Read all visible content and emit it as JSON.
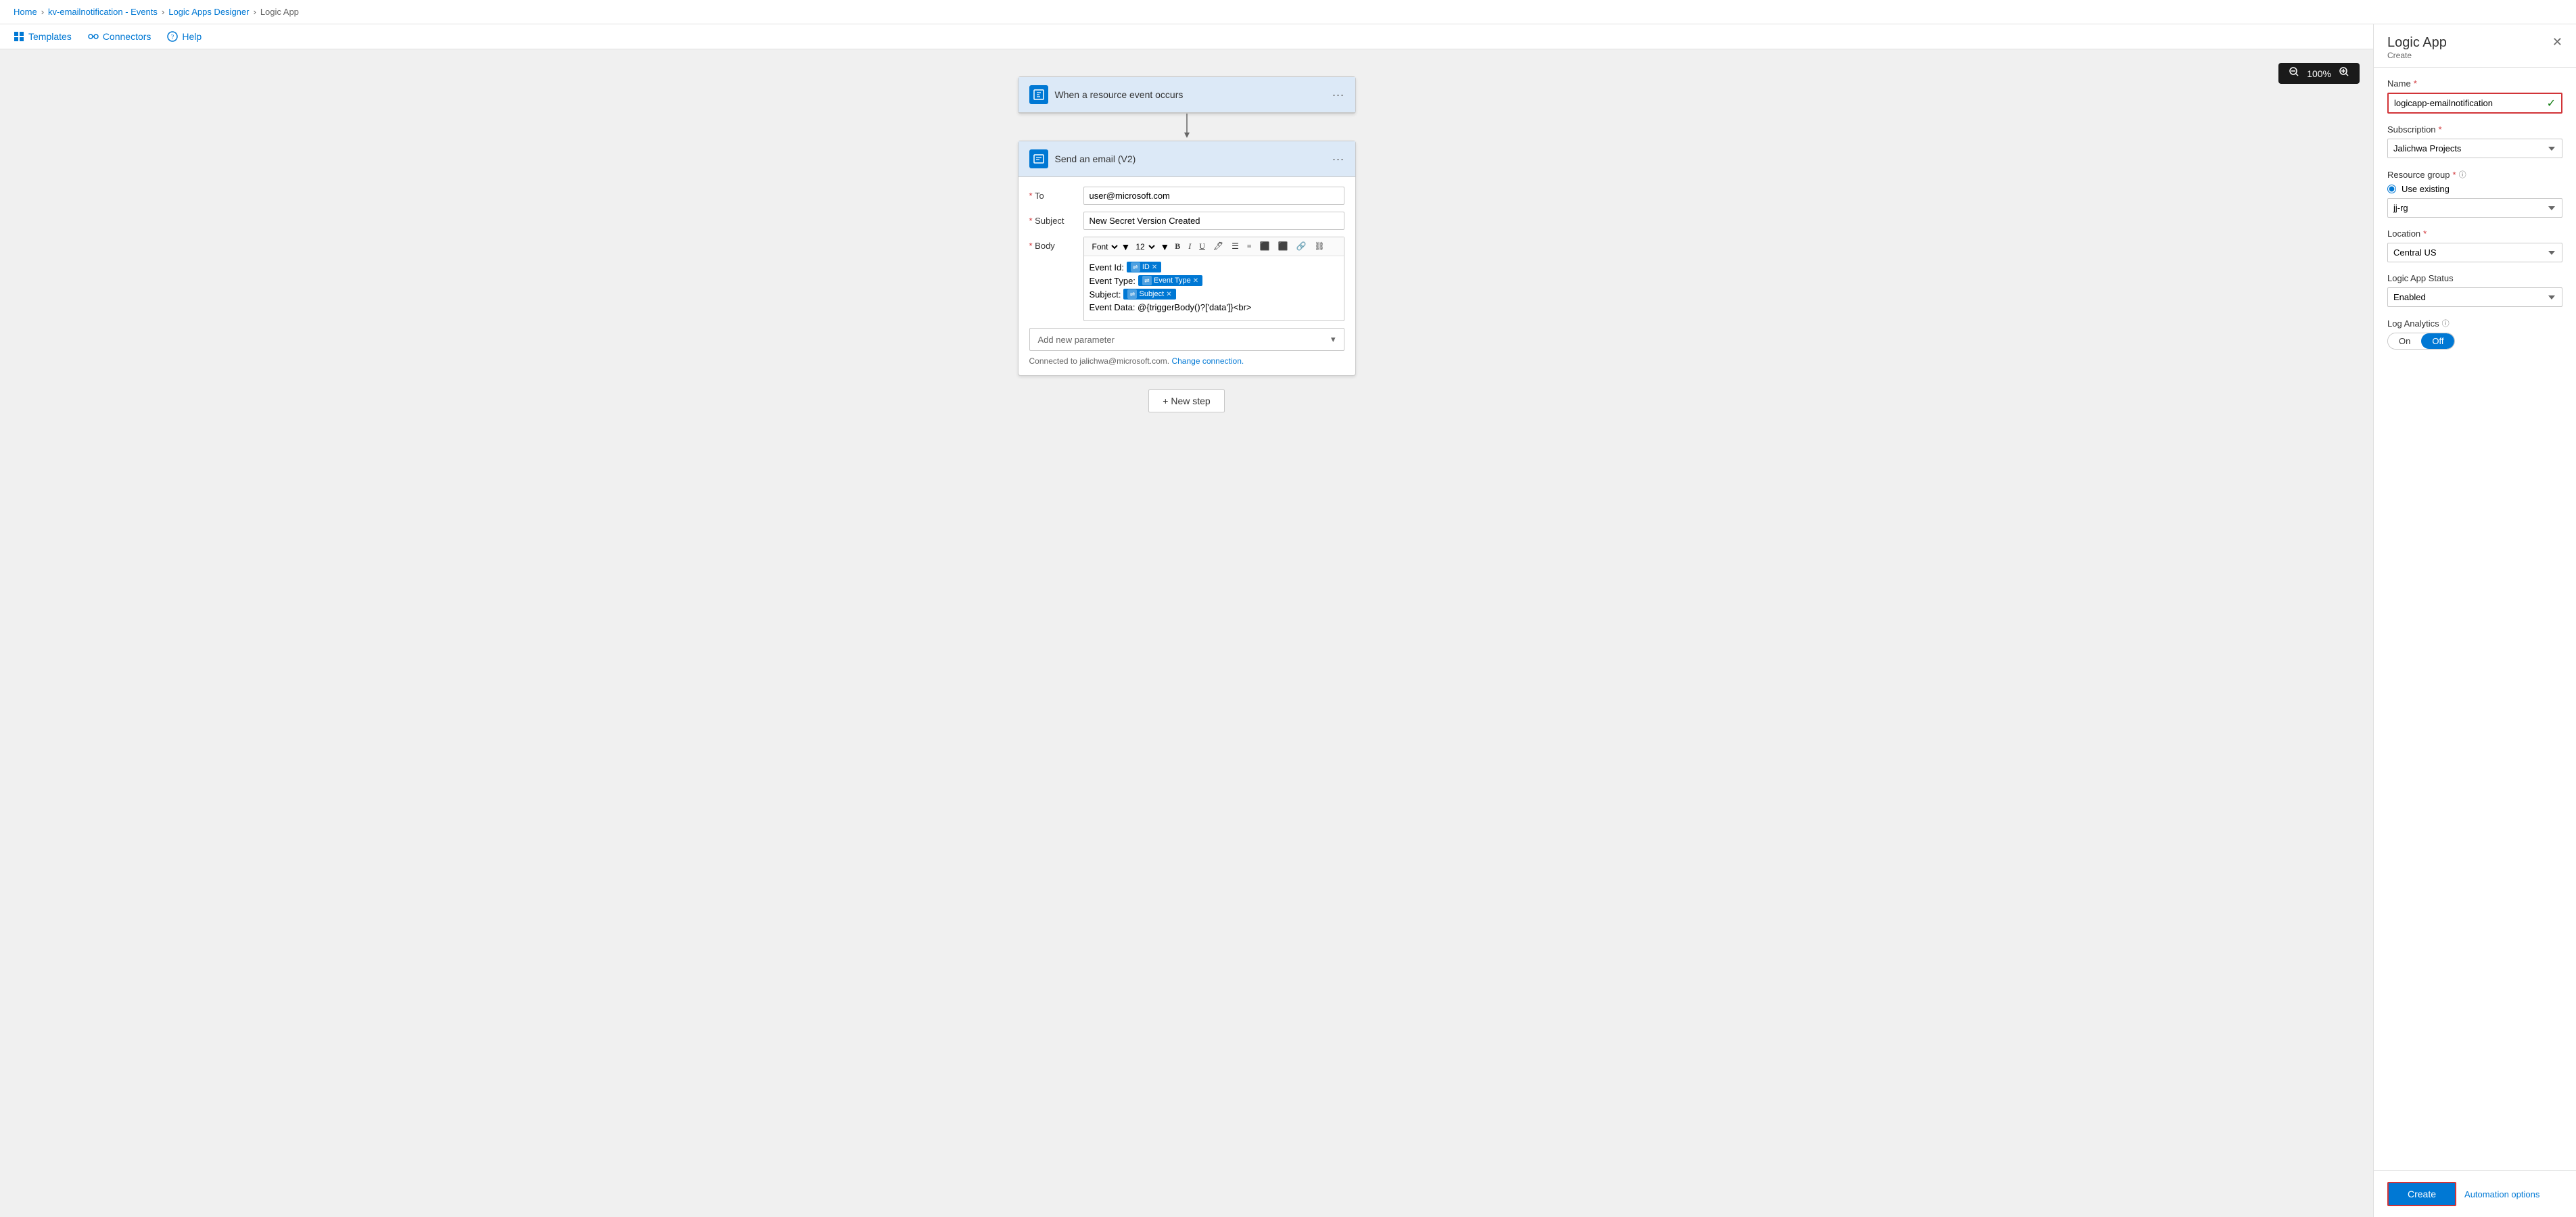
{
  "breadcrumb": {
    "items": [
      "Home",
      "kv-emailnotification - Events",
      "Logic Apps Designer",
      "Logic App"
    ]
  },
  "toolbar": {
    "templates_label": "Templates",
    "connectors_label": "Connectors",
    "help_label": "Help"
  },
  "zoom": {
    "level": "100%"
  },
  "designer": {
    "trigger_card": {
      "title": "When a resource event occurs"
    },
    "action_card": {
      "title": "Send an email (V2)",
      "to_label": "To",
      "to_value": "user@microsoft.com",
      "subject_label": "Subject",
      "subject_value": "New Secret Version Created",
      "body_label": "Body",
      "body_font": "Font",
      "body_size": "12",
      "body_content": {
        "line1_prefix": "Event Id:",
        "line1_token": "ID",
        "line2_prefix": "Event Type:",
        "line2_token": "Event Type",
        "line3_prefix": "Subject:",
        "line3_token": "Subject",
        "line4": "Event Data: @{triggerBody()?['data']}<br>"
      },
      "add_param_label": "Add new parameter",
      "connection_text": "Connected to jalichwa@microsoft.com.",
      "change_connection": "Change connection."
    },
    "new_step_label": "+ New step"
  },
  "right_panel": {
    "title": "Logic App",
    "subtitle": "Create",
    "name_label": "Name",
    "name_required": "*",
    "name_value": "logicapp-emailnotification",
    "subscription_label": "Subscription",
    "subscription_required": "*",
    "subscription_value": "Jalichwa Projects",
    "resource_group_label": "Resource group",
    "resource_group_required": "*",
    "resource_group_info": "ⓘ",
    "use_existing_label": "Use existing",
    "resource_group_value": "jj-rg",
    "location_label": "Location",
    "location_required": "*",
    "location_value": "Central US",
    "logic_app_status_label": "Logic App Status",
    "status_value": "Enabled",
    "log_analytics_label": "Log Analytics",
    "log_analytics_info": "ⓘ",
    "toggle_on": "On",
    "toggle_off": "Off",
    "create_label": "Create",
    "automation_label": "Automation options"
  }
}
